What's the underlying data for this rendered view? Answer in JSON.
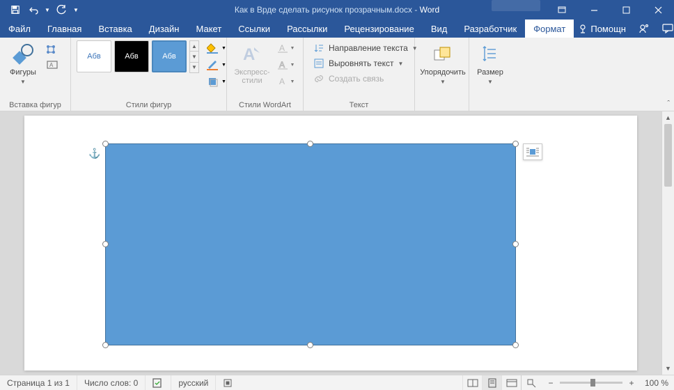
{
  "title": {
    "doc": "Как в Врде сделать рисунок прозрачным.docx",
    "sep": " - ",
    "app": "Word"
  },
  "tabs": {
    "file": "Файл",
    "home": "Главная",
    "insert": "Вставка",
    "design": "Дизайн",
    "layout": "Макет",
    "references": "Ссылки",
    "mailings": "Рассылки",
    "review": "Рецензирование",
    "view": "Вид",
    "developer": "Разработчик",
    "format": "Формат",
    "help": "Помощн"
  },
  "ribbon": {
    "insert_shapes": {
      "shapes": "Фигуры",
      "group": "Вставка фигур"
    },
    "shape_styles": {
      "swatch_label": "Абв",
      "group": "Стили фигур"
    },
    "wordart": {
      "express": "Экспресс-стили",
      "group": "Стили WordArt"
    },
    "text": {
      "direction": "Направление текста",
      "align": "Выровнять текст",
      "link": "Создать связь",
      "group": "Текст"
    },
    "arrange": {
      "btn": "Упорядочить"
    },
    "size": {
      "btn": "Размер"
    }
  },
  "status": {
    "page": "Страница 1 из 1",
    "words": "Число слов: 0",
    "lang": "русский",
    "zoom": "100 %"
  },
  "icons": {
    "save": "save",
    "undo": "undo",
    "redo": "redo",
    "dropdown": "▾",
    "minus": "−",
    "plus": "+"
  }
}
